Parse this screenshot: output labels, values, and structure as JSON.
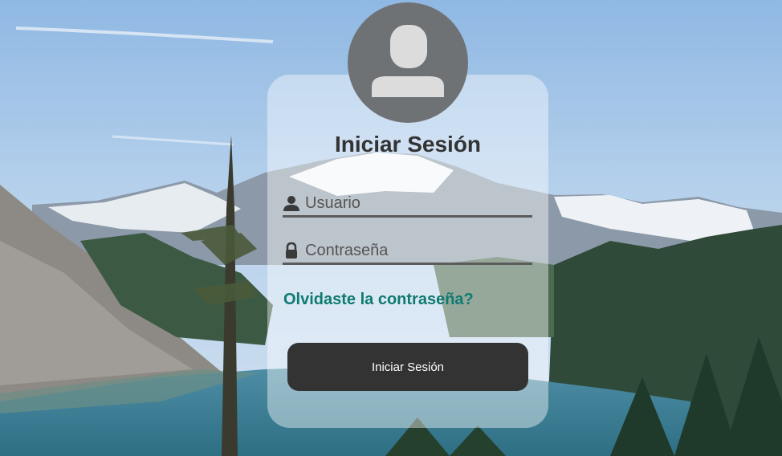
{
  "login": {
    "title": "Iniciar Sesión",
    "username": {
      "placeholder": "Usuario",
      "value": "",
      "icon": "user-icon"
    },
    "password": {
      "placeholder": "Contraseña",
      "value": "",
      "icon": "lock-icon"
    },
    "forgot_link": "Olvidaste la contraseña?",
    "submit_label": "Iniciar Sesión",
    "avatar_icon": "user-avatar-icon"
  },
  "colors": {
    "card_background": "#ffffff",
    "title": "#333333",
    "link": "#0e7a72",
    "button": "#333333",
    "button_text": "#ffffff",
    "avatar": "#6f7275",
    "underline": "#5b5b5b"
  },
  "background": {
    "description_icon": "mountain-lake-landscape"
  }
}
